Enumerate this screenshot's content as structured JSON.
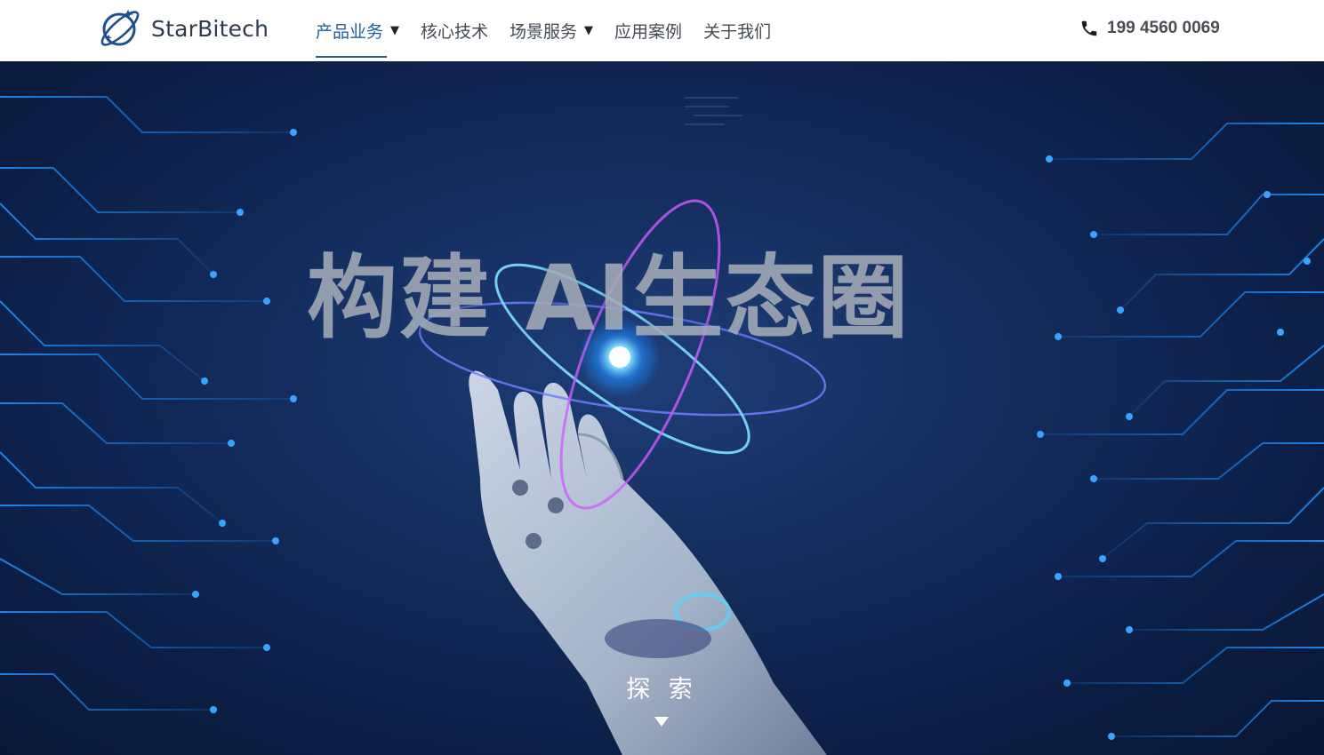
{
  "header": {
    "logo_text": "StarBitech",
    "nav": [
      {
        "label": "产品业务",
        "caret": "▼"
      },
      {
        "label": "核心技术"
      },
      {
        "label": "场景服务",
        "caret": "▼"
      },
      {
        "label": "应用案例"
      },
      {
        "label": "关于我们"
      }
    ],
    "active_nav": "产品业务",
    "phone_icon": "phone-icon",
    "phone_number": "199 4560 0069"
  },
  "hero": {
    "title": "构建 AI生态圈",
    "explore_label": "探 索",
    "explore_arrow_icon": "triangle-down-icon"
  },
  "colors": {
    "accent": "#1f5fa0",
    "nav_text": "#444b55",
    "hero_bg": "#142d5e",
    "circuit": "#1f8fff",
    "orb": "#3fd0ff"
  }
}
